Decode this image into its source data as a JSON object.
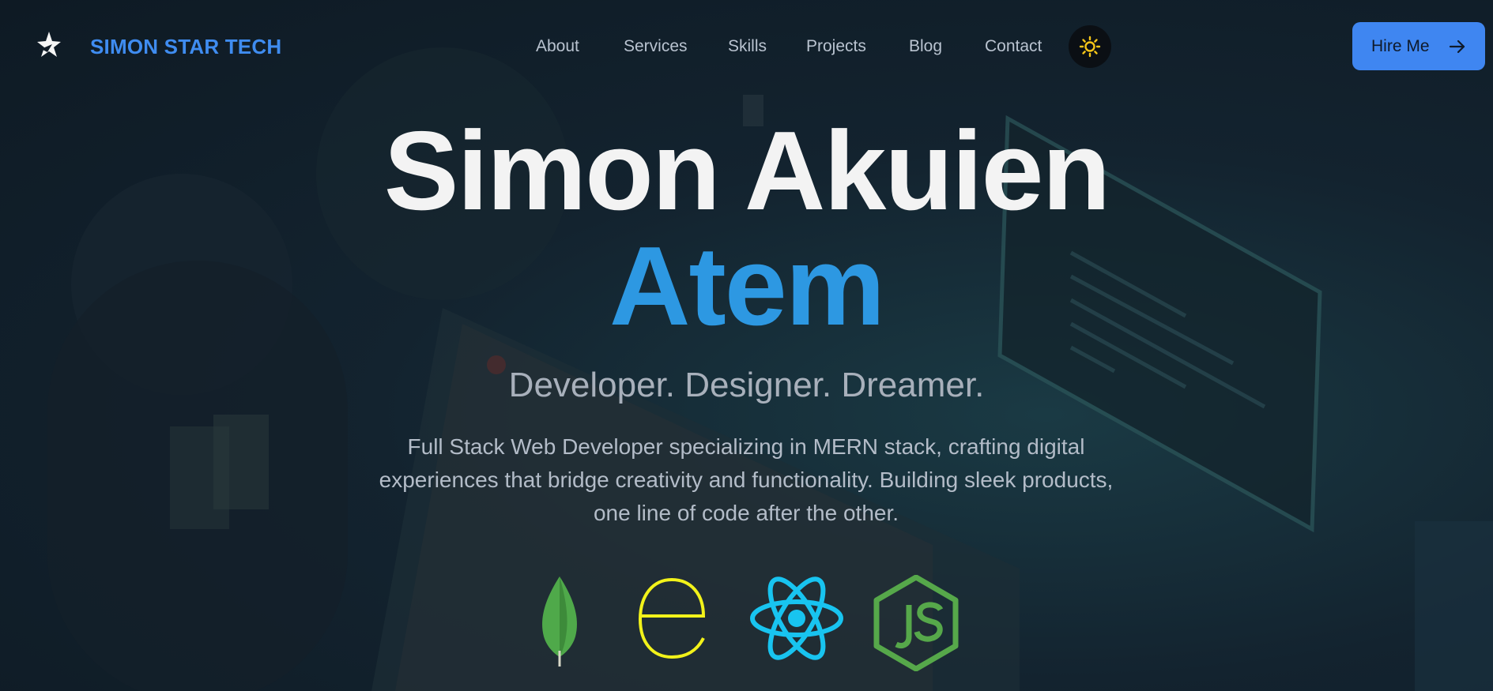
{
  "header": {
    "brand": "SIMON STAR TECH",
    "logo_icon": "star-logo-icon",
    "nav": [
      {
        "label": "About"
      },
      {
        "label": "Services"
      },
      {
        "label": "Skills"
      },
      {
        "label": "Projects"
      },
      {
        "label": "Blog"
      },
      {
        "label": "Contact"
      }
    ],
    "theme_toggle_icon": "sun-icon",
    "hire_button": {
      "label": "Hire Me",
      "icon": "arrow-right-icon"
    }
  },
  "hero": {
    "name": "Simon Akuien",
    "surname": "Atem",
    "tagline": "Developer. Designer. Dreamer.",
    "description_lines": [
      "Full Stack Web Developer specializing in MERN stack, crafting digital",
      "experiences that bridge creativity and functionality. Building sleek products,",
      "one line of code after the other."
    ]
  },
  "tech_icons": [
    "mongodb-icon",
    "express-icon",
    "react-icon",
    "nodejs-icon"
  ],
  "colors": {
    "accent": "#3f86f1",
    "surname_blue": "#2d98e2",
    "mongodb_green": "#4fa94a",
    "express_yellow": "#f2f21a",
    "react_cyan": "#18c4f0",
    "node_green": "#56a84a",
    "sun_yellow": "#f5c518"
  }
}
